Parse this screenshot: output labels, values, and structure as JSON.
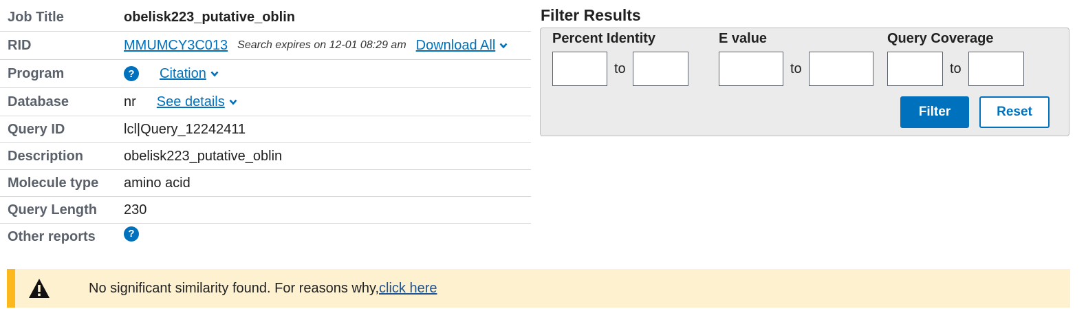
{
  "summary": {
    "rows": [
      {
        "label": "Job Title",
        "value": "obelisk223_putative_oblin"
      },
      {
        "label": "RID",
        "value": "MMUMCY3C013",
        "expires": "Search expires on 12-01 08:29 am",
        "download": "Download All"
      },
      {
        "label": "Program",
        "citation": "Citation"
      },
      {
        "label": "Database",
        "value": "nr",
        "details": "See details"
      },
      {
        "label": "Query ID",
        "value": "lcl|Query_12242411"
      },
      {
        "label": "Description",
        "value": "obelisk223_putative_oblin"
      },
      {
        "label": "Molecule type",
        "value": "amino acid"
      },
      {
        "label": "Query Length",
        "value": "230"
      },
      {
        "label": "Other reports"
      }
    ]
  },
  "filter": {
    "title": "Filter Results",
    "groups": [
      {
        "label": "Percent Identity",
        "to": "to"
      },
      {
        "label": "E value",
        "to": "to"
      },
      {
        "label": "Query Coverage",
        "to": "to"
      }
    ],
    "filter_button": "Filter",
    "reset_button": "Reset"
  },
  "banner": {
    "text": "No significant similarity found. For reasons why,",
    "link": "click here"
  },
  "icons": {
    "help": "question-circle-icon",
    "chevron": "chevron-down-icon",
    "warning": "warning-triangle-icon"
  },
  "colors": {
    "link": "#0071bc",
    "label": "#5b616b",
    "banner_bg": "#fdf1d0",
    "banner_accent": "#fdb81e"
  }
}
